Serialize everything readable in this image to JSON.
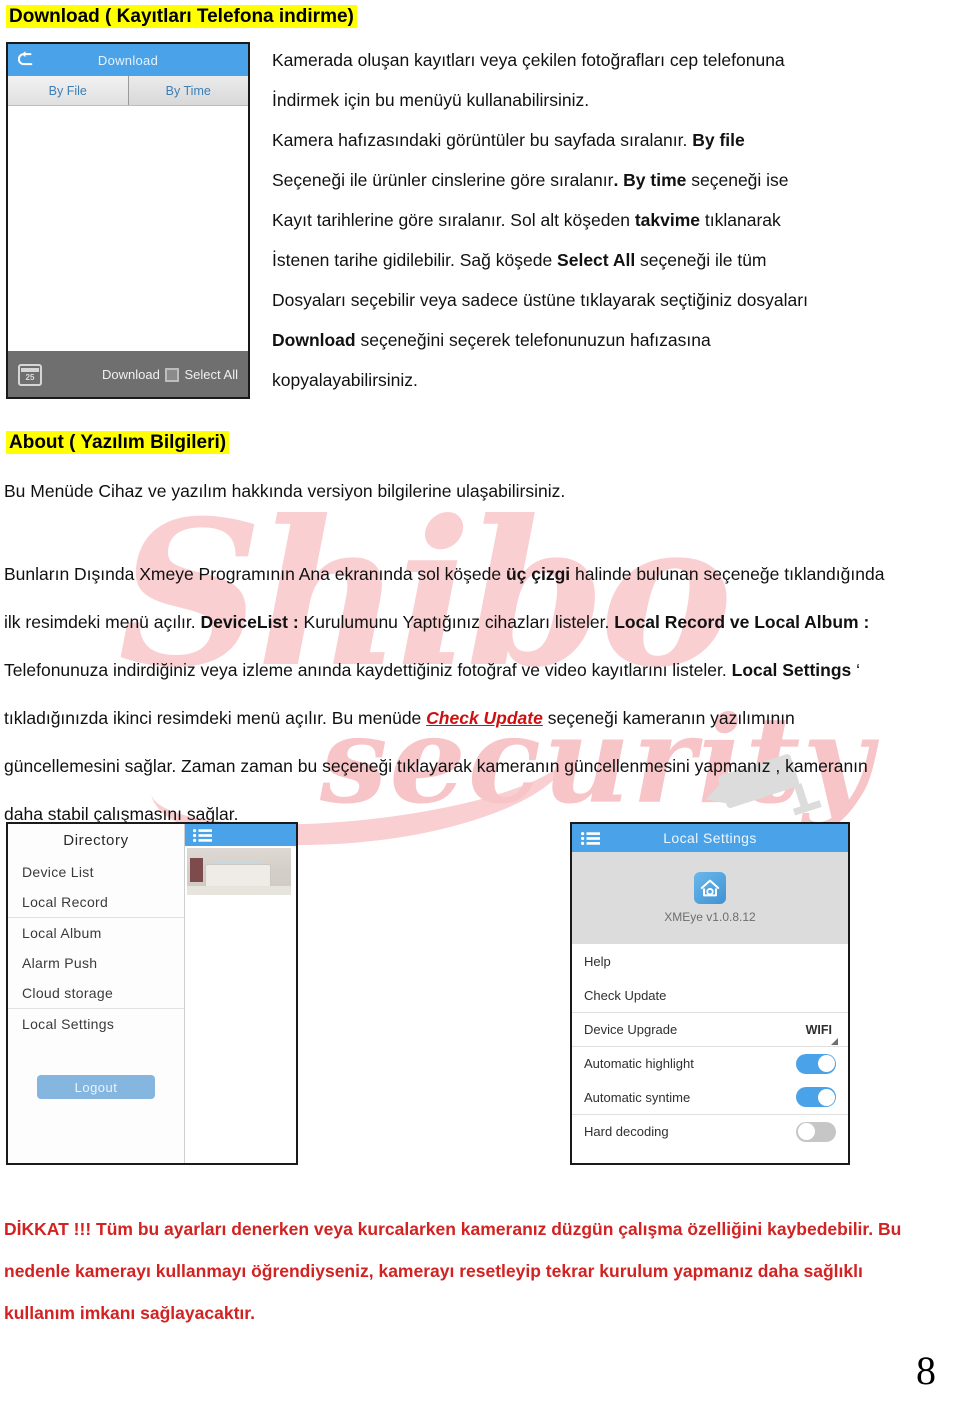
{
  "headings": {
    "download": "Download ( Kayıtları Telefona indirme)",
    "about": "About ( Yazılım Bilgileri)"
  },
  "paragraphs": {
    "download_right": {
      "l1": "Kamerada oluşan kayıtları veya çekilen fotoğrafları cep telefonuna",
      "l2": "İndirmek için bu menüyü kullanabilirsiniz.",
      "l3a": "Kamera hafızasındaki görüntüler bu sayfada sıralanır. ",
      "l3b": "By file",
      "l4a": "Seçeneği ile ürünler cinslerine göre sıralanır",
      "l4b": ". By time",
      "l4c": " seçeneği ise",
      "l5a": "Kayıt tarihlerine göre sıralanır. Sol alt köşeden ",
      "l5b": "takvime",
      "l5c": " tıklanarak",
      "l6a": "İstenen tarihe gidilebilir. Sağ köşede ",
      "l6b": "Select All",
      "l6c": " seçeneği ile tüm",
      "l7": "Dosyaları seçebilir veya sadece üstüne tıklayarak seçtiğiniz dosyaları",
      "l8a": "Download",
      "l8b": " seçeneğini seçerek telefonunuzun hafızasına",
      "l9": "kopyalayabilirsiniz."
    },
    "about_body": "Bu Menüde Cihaz ve yazılım hakkında versiyon bilgilerine ulaşabilirsiniz.",
    "main": {
      "p1a": "Bunların Dışında Xmeye Programının Ana ekranında sol köşede ",
      "p1b": "üç çizgi",
      "p1c": " halinde bulunan seçeneğe tıklandığında ilk resimdeki menü açılır. ",
      "p1d": "DeviceList :",
      "p1e": " Kurulumunu Yaptığınız cihazları listeler. ",
      "p1f": "Local Record ve Local Album :",
      "p1g": " Telefonunuza indirdiğiniz veya izleme anında kaydettiğiniz fotoğraf ve video kayıtlarını listeler. ",
      "p1h": "Local Settings",
      "p1i": " ‘ tıkladığınızda ikinci resimdeki menü açılır. Bu menüde ",
      "p1j": "Check Update",
      "p1k": " seçeneği kameranın yazılımının güncellemesini sağlar. Zaman zaman bu seçeneği tıklayarak kameranın güncellenmesini yapmanız , kameranın daha stabil çalışmasını sağlar."
    },
    "warning": "DİKKAT !!! Tüm bu ayarları denerken veya kurcalarken kameranız düzgün çalışma özelliğini kaybedebilir. Bu nedenle kamerayı kullanmayı öğrendiyseniz, kamerayı resetleyip tekrar kurulum yapmanız daha sağlıklı kullanım imkanı sağlayacaktır."
  },
  "download_mockup": {
    "title": "Download",
    "back_icon": "back-arrow-icon",
    "tabs": [
      "By File",
      "By Time"
    ],
    "calendar_icon_label": "25",
    "download_label": "Download",
    "select_all_label": "Select All"
  },
  "directory_mockup": {
    "header": "Directory",
    "items": [
      "Device List",
      "Local Record",
      "Local Album",
      "Alarm Push",
      "Cloud storage",
      "Local Settings"
    ],
    "logout_label": "Logout",
    "menu_icon": "hamburger-icon"
  },
  "settings_mockup": {
    "title": "Local Settings",
    "menu_icon": "hamburger-icon",
    "app_icon": "xmeye-home-camera-icon",
    "version": "XMEye v1.0.8.12",
    "rows": [
      {
        "label": "Help",
        "type": "plain"
      },
      {
        "label": "Check Update",
        "type": "plain"
      },
      {
        "label": "Device Upgrade",
        "type": "value",
        "value": "WIFI"
      },
      {
        "label": "Automatic highlight",
        "type": "toggle",
        "on": true
      },
      {
        "label": "Automatic syntime",
        "type": "toggle",
        "on": true
      },
      {
        "label": "Hard decoding",
        "type": "toggle",
        "on": false
      }
    ]
  },
  "watermark": {
    "brand": "Shibo",
    "tagline": "security"
  },
  "page_number": "8",
  "colors": {
    "highlight": "#ffff00",
    "accent_blue": "#4aa3e8",
    "warning_red": "#d22222",
    "link_red": "#cc1111",
    "watermark_pink": "#f9cfd2"
  }
}
